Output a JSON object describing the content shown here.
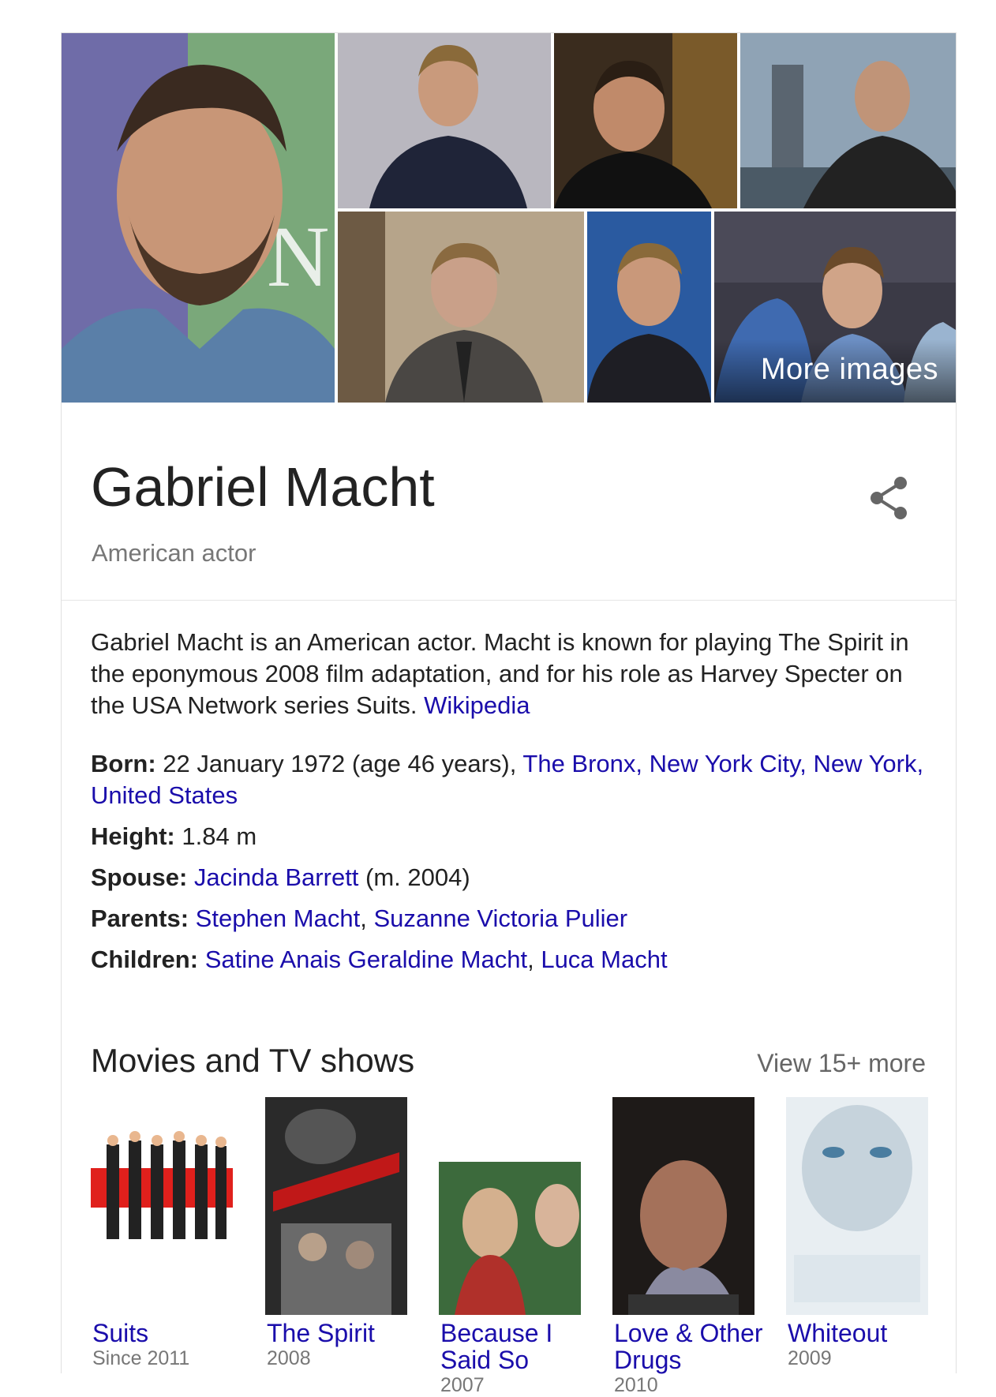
{
  "gallery": {
    "more_images_label": "More images"
  },
  "entity": {
    "name": "Gabriel Macht",
    "subtitle": "American actor"
  },
  "description": {
    "text": "Gabriel Macht is an American actor. Macht is known for playing The Spirit in the eponymous 2008 film adaptation, and for his role as Harvey Specter on the USA Network series Suits. ",
    "source_link": "Wikipedia"
  },
  "facts": {
    "born": {
      "label": "Born:",
      "value": " 22 January 1972 (age 46 years), ",
      "place": "The Bronx, New York City, New York, United States"
    },
    "height": {
      "label": "Height:",
      "value": " 1.84 m"
    },
    "spouse": {
      "label": "Spouse:",
      "name": "Jacinda Barrett",
      "detail": " (m. 2004)"
    },
    "parents": {
      "label": "Parents:",
      "names": [
        "Stephen Macht",
        "Suzanne Victoria Pulier"
      ]
    },
    "children": {
      "label": "Children:",
      "names": [
        "Satine Anais Geraldine Macht",
        "Luca Macht"
      ]
    }
  },
  "movies": {
    "heading": "Movies and TV shows",
    "view_more": "View 15+ more",
    "items": [
      {
        "title": "Suits",
        "year": "Since 2011"
      },
      {
        "title": "The Spirit",
        "year": "2008"
      },
      {
        "title": "Because I Said So",
        "year": "2007"
      },
      {
        "title": "Love & Other Drugs",
        "year": "2010"
      },
      {
        "title": "Whiteout",
        "year": "2009"
      }
    ]
  },
  "icons": {
    "share": "share-icon"
  },
  "colors": {
    "link": "#1a0dab",
    "secondary_text": "#777777",
    "divider": "#e6e6e6"
  }
}
